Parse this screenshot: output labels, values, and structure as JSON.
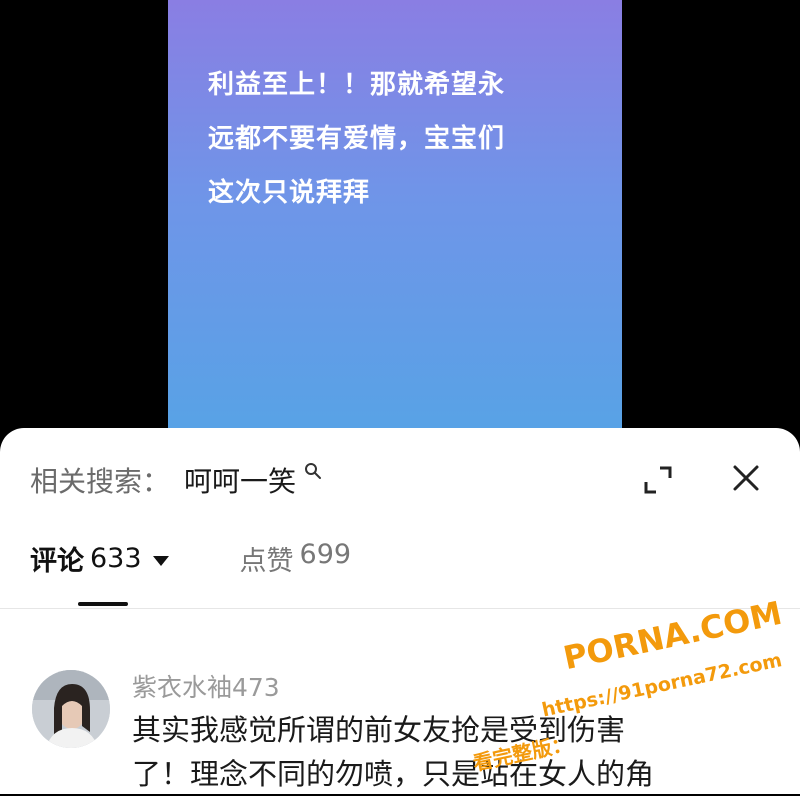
{
  "video": {
    "text_lines": [
      "利益至上！！那就希望永",
      "远都不要有爱情，宝宝们",
      "这次只说拜拜"
    ]
  },
  "search": {
    "label": "相关搜索：",
    "term": "呵呵一笑"
  },
  "tabs": {
    "comments_label": "评论",
    "comments_count": "633",
    "likes_label": "点赞",
    "likes_count": "699"
  },
  "comment": {
    "username": "紫衣水袖473",
    "text_lines": [
      "其实我感觉所谓的前女友抢是受到伤害",
      "了！理念不同的勿喷，只是站在女人的角"
    ]
  },
  "watermark": {
    "site": "PORNA.COM",
    "url": "https://91porna72.com",
    "prefix": "看完整版："
  }
}
